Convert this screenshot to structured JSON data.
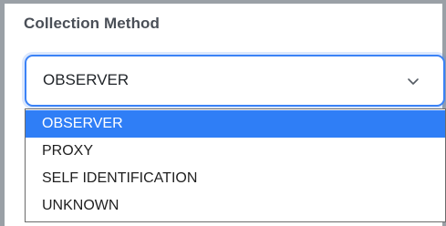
{
  "field": {
    "label": "Collection Method",
    "selected_value": "OBSERVER",
    "chevron_icon": "chevron-down-icon"
  },
  "dropdown": {
    "options": [
      {
        "label": "OBSERVER",
        "selected": true
      },
      {
        "label": "PROXY",
        "selected": false
      },
      {
        "label": "SELF IDENTIFICATION",
        "selected": false
      },
      {
        "label": "UNKNOWN",
        "selected": false
      }
    ]
  },
  "colors": {
    "accent": "#2f7ef6",
    "focus_border": "#3b82f6",
    "label_text": "#4a4f57"
  }
}
